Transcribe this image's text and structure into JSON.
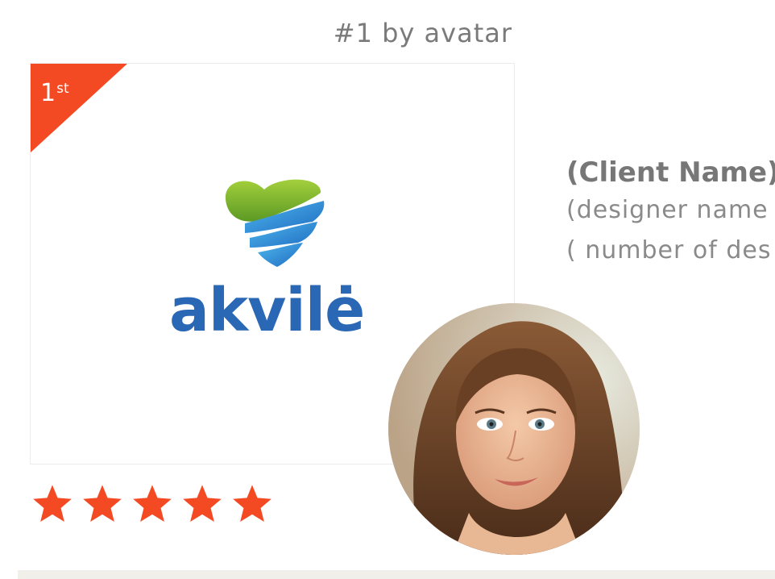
{
  "heading": "#1 by avatar",
  "rank": {
    "number": "1",
    "suffix": "st"
  },
  "logo": {
    "wordmark": "akvilė",
    "icon": "heart-waves-icon"
  },
  "rating": {
    "value": 5,
    "max": 5,
    "icon": "star-icon",
    "color": "#f44a24"
  },
  "client": {
    "name": "(Client Name)",
    "designer": "(designer name",
    "design_count": "( number of des"
  },
  "avatar": {
    "icon": "designer-avatar"
  },
  "colors": {
    "accent": "#f44a24",
    "brand_blue": "#2a68b6",
    "brand_green": "#7bb52c",
    "text_gray": "#7a7a7a"
  }
}
